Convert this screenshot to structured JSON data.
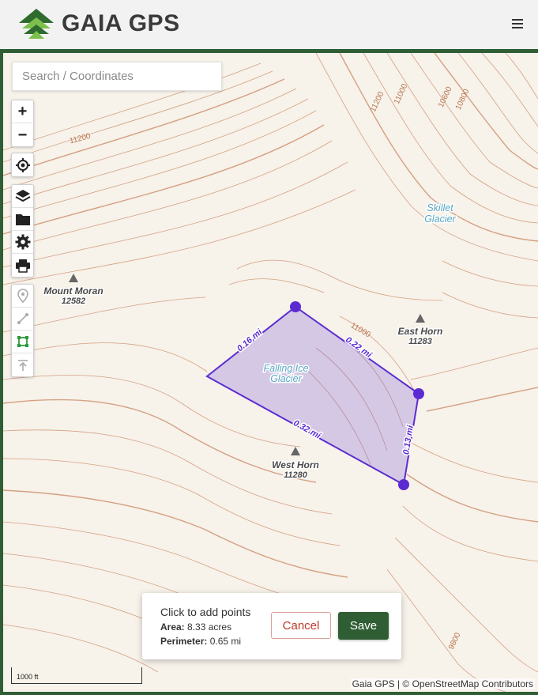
{
  "header": {
    "logo_text": "GAIA GPS",
    "logo_colors": {
      "dark": "#2f6b2f",
      "light": "#7cc04b"
    }
  },
  "search": {
    "placeholder": "Search / Coordinates"
  },
  "map_controls": {
    "zoom_in": "+",
    "zoom_out": "−",
    "icons": [
      "locate-icon",
      "layers-icon",
      "folder-icon",
      "settings-icon",
      "print-icon",
      "waypoint-icon",
      "route-icon",
      "area-icon",
      "track-icon"
    ]
  },
  "map_labels": {
    "peaks": [
      {
        "name": "Mount Moran",
        "elevation": "12582"
      },
      {
        "name": "East Horn",
        "elevation": "11283"
      },
      {
        "name": "West Horn",
        "elevation": "11280"
      }
    ],
    "glaciers": [
      {
        "line1": "Skillet",
        "line2": "Glacier"
      },
      {
        "line1": "Falling Ice",
        "line2": "Glacier"
      }
    ],
    "contours": [
      "11200",
      "11200",
      "11000",
      "10600",
      "10800",
      "11000",
      "9800"
    ],
    "segments": [
      "0.16 mi",
      "0.22 mi",
      "0.32 mi",
      "0.13 mi"
    ]
  },
  "draw_panel": {
    "instruction": "Click to add points",
    "area_label": "Area:",
    "area_value": "8.33 acres",
    "perimeter_label": "Perimeter:",
    "perimeter_value": "0.65 mi",
    "cancel_label": "Cancel",
    "save_label": "Save"
  },
  "scale": {
    "label": "1000 ft"
  },
  "attribution": "Gaia GPS | © OpenStreetMap Contributors",
  "colors": {
    "brand_green": "#2f5d34",
    "polygon": "#5b2bd1",
    "contour": "#c9835a",
    "cancel": "#c0392b"
  }
}
